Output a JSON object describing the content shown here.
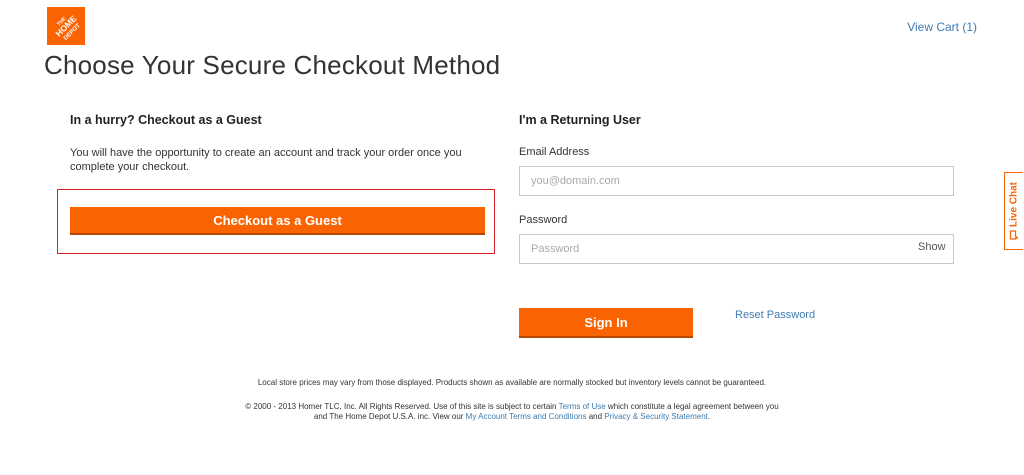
{
  "header": {
    "logo_text": "THE HOME DEPOT",
    "view_cart": "View Cart (1)",
    "page_title": "Choose Your Secure Checkout Method"
  },
  "guest": {
    "heading": "In a hurry? Checkout as a Guest",
    "description": "You will have the opportunity to create an account and track your order once you complete your checkout.",
    "button_label": "Checkout as a Guest"
  },
  "returning": {
    "heading": "I'm a Returning User",
    "email_label": "Email Address",
    "email_placeholder": "you@domain.com",
    "password_label": "Password",
    "password_placeholder": "Password",
    "show_label": "Show",
    "signin_label": "Sign In",
    "reset_label": "Reset Password"
  },
  "live_chat": {
    "label": "Live Chat",
    "icon": "chat-bubble-icon"
  },
  "footer": {
    "price_note": "Local store prices may vary from those displayed. Products shown as available are normally stocked but inventory levels cannot be guaranteed.",
    "copy_part1": "© 2000 - 2013 Homer TLC, Inc. All Rights Reserved. Use of this site is subject to certain ",
    "terms_link": "Terms of Use",
    "copy_part2": " which constitute a legal agreement between you and The Home Depot U.S.A. inc. View our ",
    "account_link": "My Account Terms and Conditions",
    "copy_part3": " and ",
    "privacy_link": "Privacy & Security Statement",
    "copy_part4": "."
  },
  "colors": {
    "brand_orange": "#f96302",
    "link_blue": "#3e7cb1",
    "highlight_red": "#d8202a"
  }
}
